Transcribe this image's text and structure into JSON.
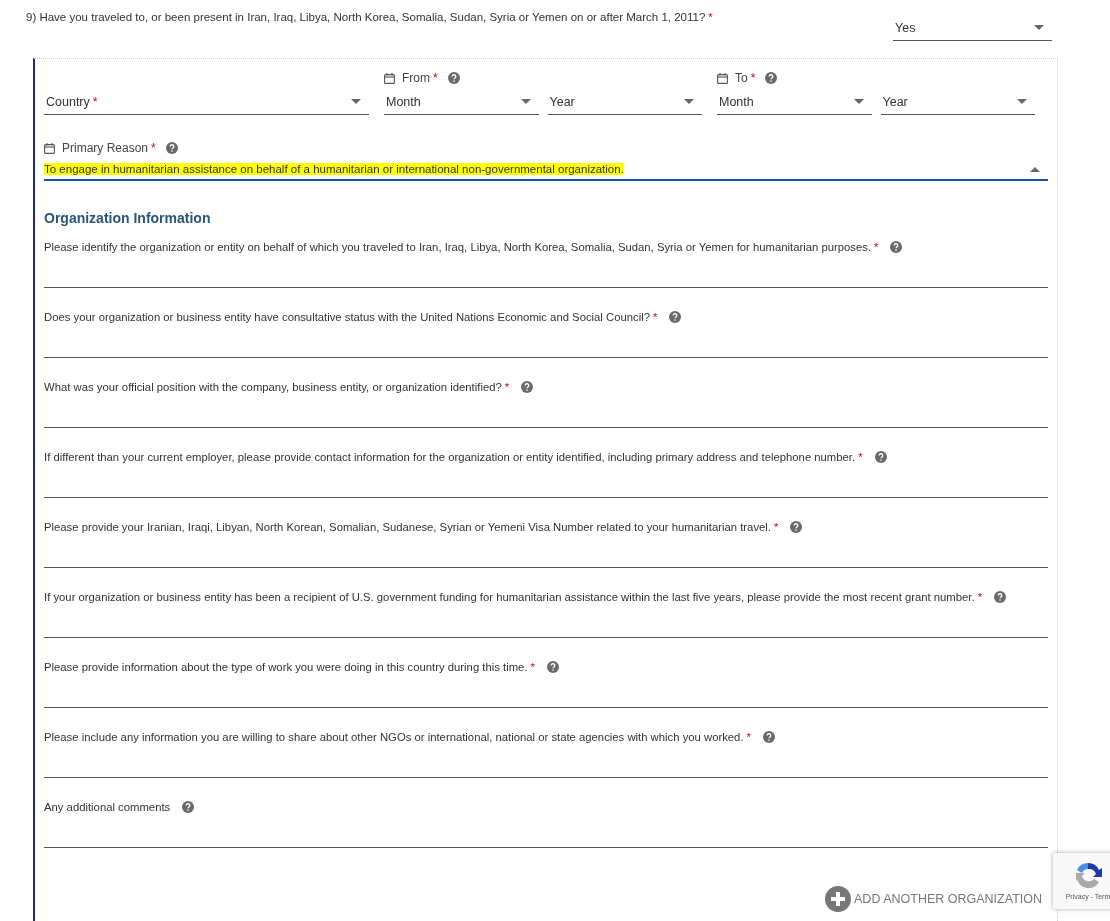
{
  "question": {
    "text": "9) Have you traveled to, or been present in Iran, Iraq, Libya, North Korea, Somalia, Sudan, Syria or Yemen on or after March 1, 2011?",
    "mark": "*",
    "answer": {
      "value": "Yes",
      "expanded": false
    }
  },
  "travel": {
    "country": {
      "label": "Country",
      "mark": "*",
      "expanded": false
    },
    "from": {
      "label": "From",
      "mark": "*",
      "month": "Month",
      "year": "Year"
    },
    "to": {
      "label": "To",
      "mark": "*",
      "month": "Month",
      "year": "Year"
    },
    "primary_reason": {
      "label": "Primary Reason",
      "mark": "*",
      "value": "To engage in humanitarian assistance on behalf of a humanitarian or international non-governmental organization.",
      "expanded": true,
      "highlighted": true
    }
  },
  "organization": {
    "heading": "Organization Information",
    "questions": [
      {
        "label": "Please identify the organization or entity on behalf of which you traveled to Iran, Iraq, Libya, North Korea, Somalia, Sudan, Syria or Yemen for humanitarian purposes.",
        "mark": "*"
      },
      {
        "label": "Does your organization or business entity have consultative status with the United Nations Economic and Social Council?",
        "mark": "*"
      },
      {
        "label": "What was your official position with the company, business entity, or organization identified?",
        "mark": "*"
      },
      {
        "label": "If different than your current employer, please provide contact information for the organization or entity identified, including primary address and telephone number.",
        "mark": "*"
      },
      {
        "label": "Please provide your Iranian, Iraqi, Libyan, North Korean, Somalian, Sudanese, Syrian or Yemeni Visa Number related to your humanitarian travel.",
        "mark": "*"
      },
      {
        "label": "If your organization or business entity has been a recipient of U.S. government funding for humanitarian assistance within the last five years, please provide the most recent grant number.",
        "mark": "*"
      },
      {
        "label": "Please provide information about the type of work you were doing in this country during this time.",
        "mark": "*"
      },
      {
        "label": "Please include any information you are willing to share about other NGOs or international, national or state agencies with which you worked.",
        "mark": "*"
      },
      {
        "label": "Any additional comments"
      }
    ],
    "add_button": "ADD ANOTHER ORGANIZATION"
  },
  "recaptcha": {
    "links": "Privacy - Term"
  }
}
